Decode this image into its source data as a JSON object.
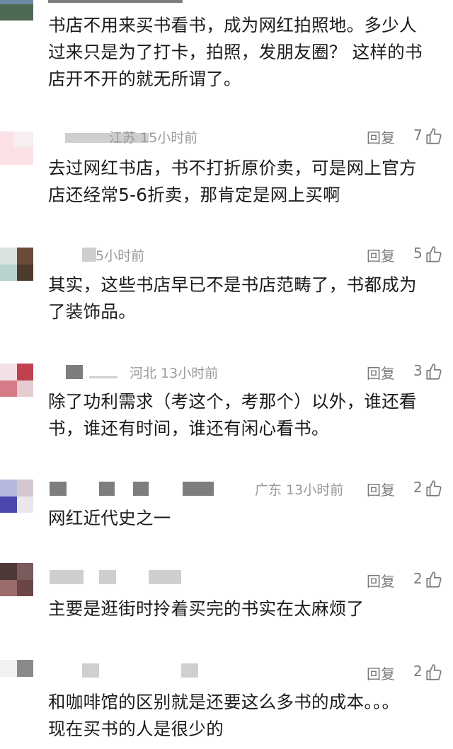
{
  "comments": [
    {
      "lines": [
        "书店不用来买书看书，成为网红拍照地。多少人",
        "过来只是为了打卡，拍照，发朋友圈？ 这样的书",
        "店开不开的就无所谓了。"
      ]
    },
    {
      "meta": "江苏 15小时前",
      "reply": "回复",
      "likes": "7",
      "lines": [
        "去过网红书店，书不打折原价卖，可是网上官方",
        "店还经常5-6折卖，那肯定是网上买啊"
      ]
    },
    {
      "meta": "5小时前",
      "reply": "回复",
      "likes": "5",
      "lines": [
        "其实，这些书店早已不是书店范畴了，书都成为",
        "了装饰品。"
      ]
    },
    {
      "meta": "河北 13小时前",
      "reply": "回复",
      "likes": "3",
      "lines": [
        "除了功利需求（考这个，考那个）以外，谁还看",
        "书，谁还有时间，谁还有闲心看书。"
      ]
    },
    {
      "meta": "广东 13小时前",
      "reply": "回复",
      "likes": "2",
      "lines": [
        "网红近代史之一"
      ]
    },
    {
      "reply": "回复",
      "likes": "2",
      "lines": [
        "主要是逛街时拎着买完的书实在太麻烦了"
      ]
    },
    {
      "reply": "回复",
      "likes": "2",
      "lines": [
        "和咖啡馆的区别就是还要这么多书的成本。。。",
        "现在买书的人是很少的"
      ]
    }
  ],
  "icons": {
    "like": "thumbs-up-icon"
  },
  "colors": {
    "text": "#1a1a1a",
    "meta": "#9a9a9a",
    "action": "#7a7a7a"
  }
}
